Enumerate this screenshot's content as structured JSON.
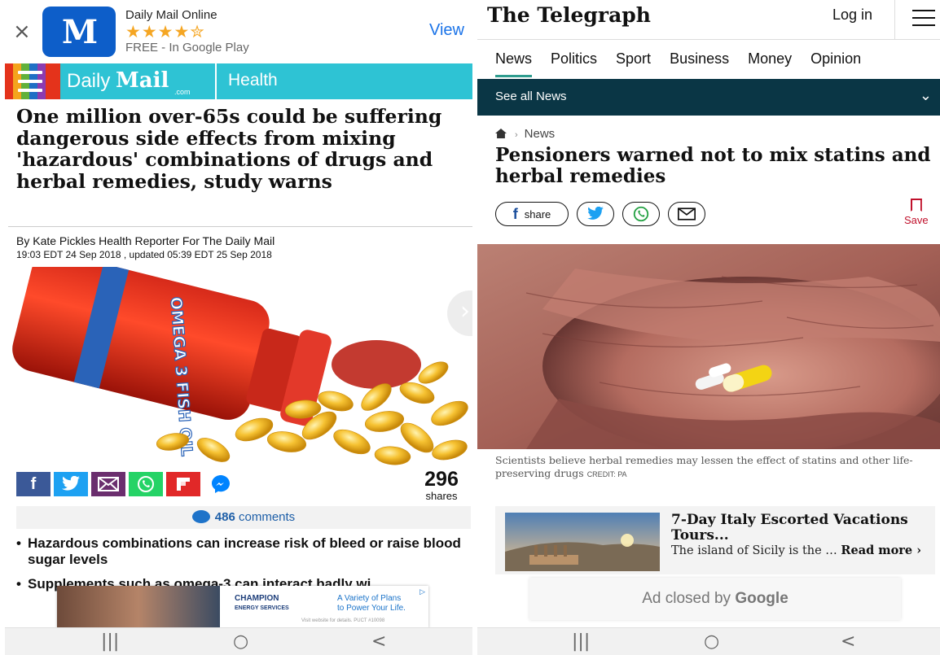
{
  "dailymail": {
    "app_banner": {
      "close": "×",
      "logo_letter": "M",
      "app_name": "Daily Mail Online",
      "stars": "★★★★✮",
      "price": "FREE - In Google Play",
      "cta": "View"
    },
    "header": {
      "logo_daily": "Daily",
      "logo_mail": "Mail",
      "logo_suffix": ".com",
      "section": "Health"
    },
    "headline": "One million over-65s could be suffering dangerous side effects from mixing 'hazardous' combinations of drugs and herbal remedies, study warns",
    "byline": "By Kate Pickles Health Reporter For The Daily Mail",
    "timestamp": "19:03 EDT 24 Sep 2018 , updated 05:39 EDT 25 Sep 2018",
    "image_label": "OMEGA 3 FISH OIL",
    "share": {
      "count": "296",
      "count_label": "shares",
      "colors": {
        "facebook": "#3b5998",
        "twitter": "#1da1f2",
        "email": "#6b2e6e",
        "whatsapp": "#25d366",
        "flipboard": "#e12828",
        "messenger": "#0084ff"
      }
    },
    "comments": {
      "count": "486",
      "label": "comments"
    },
    "bullets": [
      "Hazardous combinations can increase risk of bleed or raise blood sugar levels",
      "Supplements such as omega-3 can interact badly wi"
    ],
    "ad": {
      "brand": "CHAMPION",
      "brand_sub": "ENERGY SERVICES",
      "tagline_1": "A Variety of Plans",
      "tagline_2": "to Power Your Life.",
      "fine_print": "Visit website for details. PUCT #10098"
    }
  },
  "telegraph": {
    "logo": "The Telegraph",
    "login": "Log in",
    "nav": [
      "News",
      "Politics",
      "Sport",
      "Business",
      "Money",
      "Opinion"
    ],
    "see_all": "See all News",
    "breadcrumb": "News",
    "headline": "Pensioners warned not to mix statins and herbal remedies",
    "share_label": "share",
    "save_label": "Save",
    "caption": "Scientists believe herbal remedies may lessen the effect of statins and other life-preserving drugs",
    "credit": "CREDIT: PA",
    "promo": {
      "title": "7-Day Italy Escorted Vacations Tours...",
      "desc": "The island of Sicily is the …",
      "read_more": "Read more ›"
    },
    "ad_closed_prefix": "Ad closed by",
    "ad_closed_brand": "Google"
  },
  "system_nav": {
    "recent": "|||",
    "home": "○",
    "back": "<"
  },
  "accent": {
    "telegraph_bar": "#0a3645",
    "dailymail_bar": "#2ec3d4",
    "telegraph_save": "#c0102b"
  }
}
